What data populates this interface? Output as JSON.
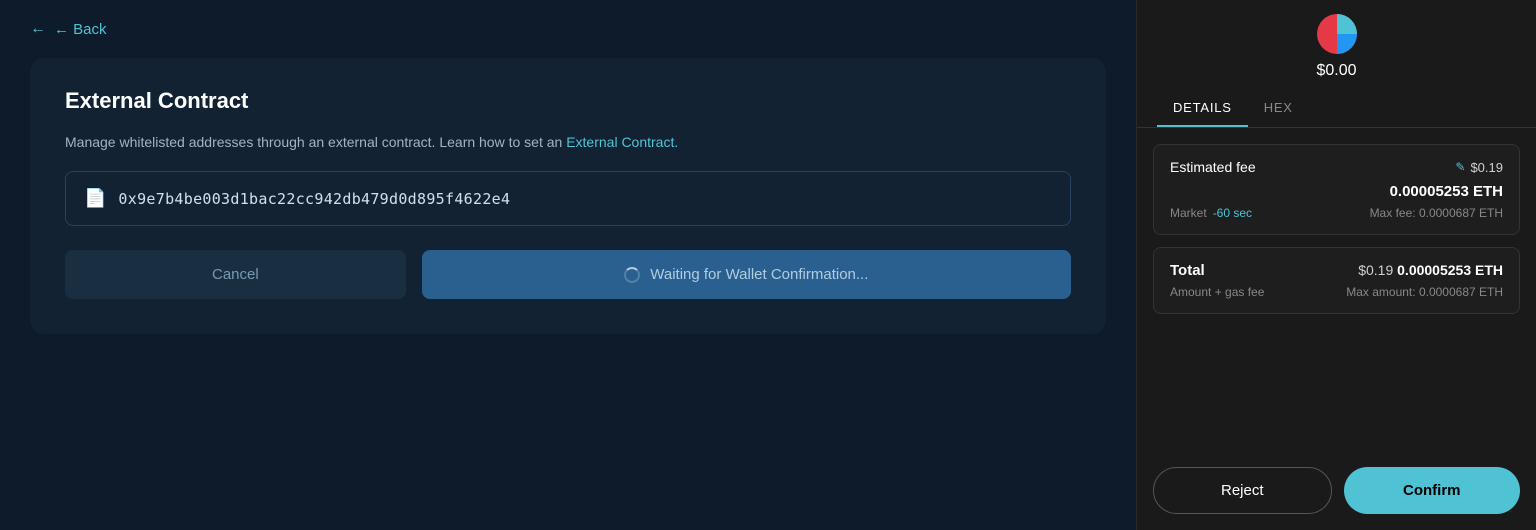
{
  "left": {
    "back_label": "← Back",
    "card": {
      "title": "External Contract",
      "description_start": "Manage whitelisted addresses through an external contract. Learn how to set an ",
      "external_link_text": "External Contract.",
      "address": "0x9e7b4be003d1bac22cc942db479d0d895f4622e4",
      "address_placeholder": "0x9e7b4be003d1bac22cc942db479d0d895f4622e4",
      "cancel_label": "Cancel",
      "waiting_label": "Waiting for Wallet Confirmation..."
    }
  },
  "right": {
    "balance": "$0.00",
    "tabs": [
      {
        "label": "DETAILS",
        "active": true
      },
      {
        "label": "HEX",
        "active": false
      }
    ],
    "fee": {
      "label": "Estimated fee",
      "usd": "$0.19",
      "eth": "0.00005253 ETH",
      "market_label": "Market",
      "time": "-60 sec",
      "max_label": "Max fee:",
      "max_value": "0.0000687 ETH"
    },
    "total": {
      "label": "Total",
      "usd": "$0.19",
      "eth": "0.00005253 ETH",
      "sub_label": "Amount + gas fee",
      "max_label": "Max amount:",
      "max_value": "0.0000687 ETH"
    },
    "reject_label": "Reject",
    "confirm_label": "Confirm"
  },
  "icons": {
    "back_arrow": "←",
    "doc": "📄",
    "edit": "✏️",
    "pie_chart": "pie"
  }
}
